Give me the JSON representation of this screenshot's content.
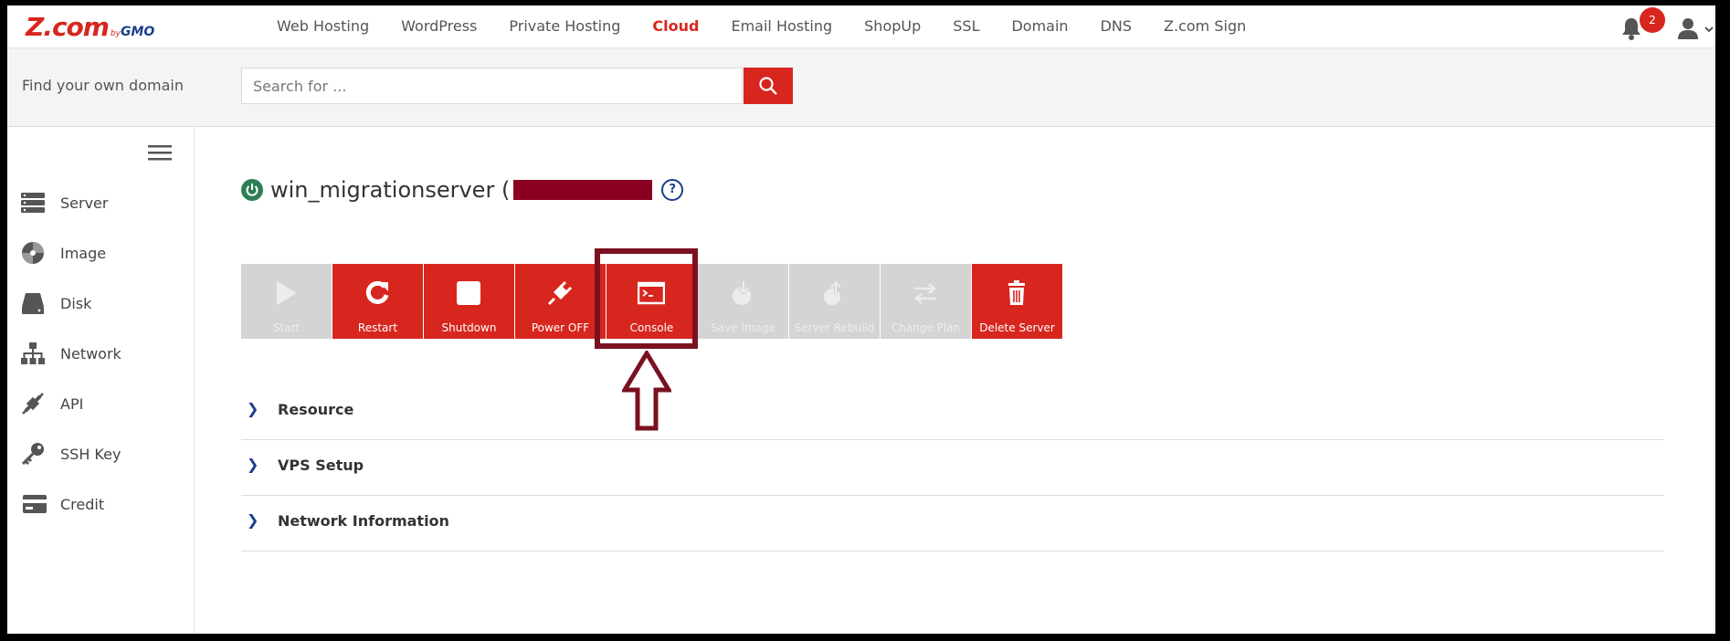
{
  "brand": {
    "logo_main": "Z.com",
    "logo_by": "by",
    "logo_gmo": "GMO"
  },
  "nav": {
    "items": [
      {
        "label": "Web Hosting"
      },
      {
        "label": "WordPress"
      },
      {
        "label": "Private Hosting"
      },
      {
        "label": "Cloud",
        "active": true
      },
      {
        "label": "Email Hosting"
      },
      {
        "label": "ShopUp"
      },
      {
        "label": "SSL"
      },
      {
        "label": "Domain"
      },
      {
        "label": "DNS"
      },
      {
        "label": "Z.com Sign"
      }
    ],
    "notification_count": "2"
  },
  "search": {
    "label": "Find your own domain",
    "placeholder": "Search for ...",
    "value": ""
  },
  "sidebar": {
    "items": [
      {
        "label": "Server",
        "icon": "server-icon"
      },
      {
        "label": "Image",
        "icon": "image-disc-icon"
      },
      {
        "label": "Disk",
        "icon": "disk-icon"
      },
      {
        "label": "Network",
        "icon": "network-icon"
      },
      {
        "label": "API",
        "icon": "api-plug-icon"
      },
      {
        "label": "SSH Key",
        "icon": "key-icon"
      },
      {
        "label": "Credit",
        "icon": "credit-card-icon"
      }
    ]
  },
  "server": {
    "name": "win_migrationserver (",
    "status": "running"
  },
  "actions": [
    {
      "label": "Start",
      "enabled": false,
      "icon": "play-icon"
    },
    {
      "label": "Restart",
      "enabled": true,
      "icon": "restart-icon"
    },
    {
      "label": "Shutdown",
      "enabled": true,
      "icon": "stop-icon"
    },
    {
      "label": "Power OFF",
      "enabled": true,
      "icon": "plug-icon"
    },
    {
      "label": "Console",
      "enabled": true,
      "icon": "console-icon"
    },
    {
      "label": "Save Image",
      "enabled": false,
      "icon": "save-image-icon"
    },
    {
      "label": "Server Rebuild",
      "enabled": false,
      "icon": "rebuild-icon"
    },
    {
      "label": "Change Plan",
      "enabled": false,
      "icon": "swap-icon"
    },
    {
      "label": "Delete Server",
      "enabled": true,
      "icon": "trash-icon"
    }
  ],
  "sections": [
    {
      "title": "Resource"
    },
    {
      "title": "VPS Setup"
    },
    {
      "title": "Network Information"
    }
  ],
  "colors": {
    "brand_red": "#d7261e",
    "disabled_gray": "#d4d4d4",
    "annotation_maroon": "#7a1120"
  }
}
